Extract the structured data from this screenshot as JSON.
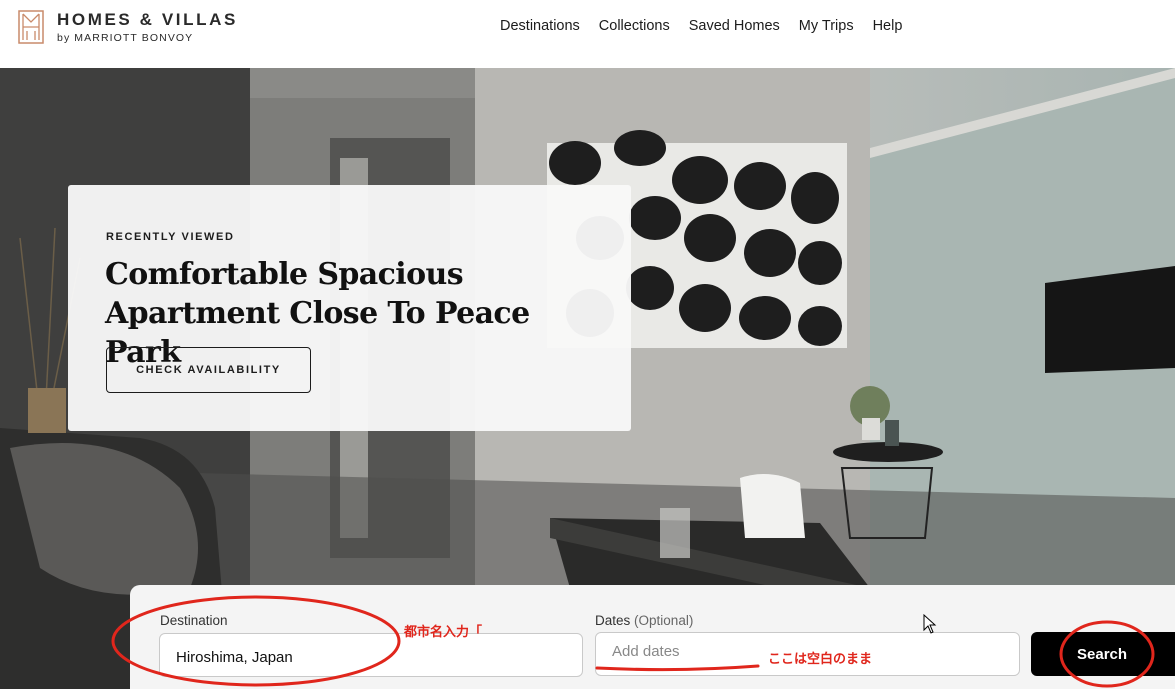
{
  "header": {
    "brand_title": "HOMES & VILLAS",
    "brand_subtitle": "by MARRIOTT BONVOY",
    "nav": [
      "Destinations",
      "Collections",
      "Saved Homes",
      "My Trips",
      "Help"
    ]
  },
  "recently_viewed": {
    "eyebrow": "RECENTLY VIEWED",
    "title": "Comfortable Spacious Apartment Close To Peace Park",
    "button_label": "CHECK AVAILABILITY"
  },
  "search": {
    "destination_label": "Destination",
    "destination_value": "Hiroshima, Japan",
    "dates_label": "Dates",
    "dates_optional": "(Optional)",
    "dates_placeholder": "Add dates",
    "search_label": "Search"
  },
  "annotations": {
    "city_note": "都市名入力「",
    "dates_note": "ここは空白のまま"
  },
  "colors": {
    "brand_accent": "#c98a6a",
    "annotation_red": "#e0261c",
    "search_button": "#000000"
  }
}
